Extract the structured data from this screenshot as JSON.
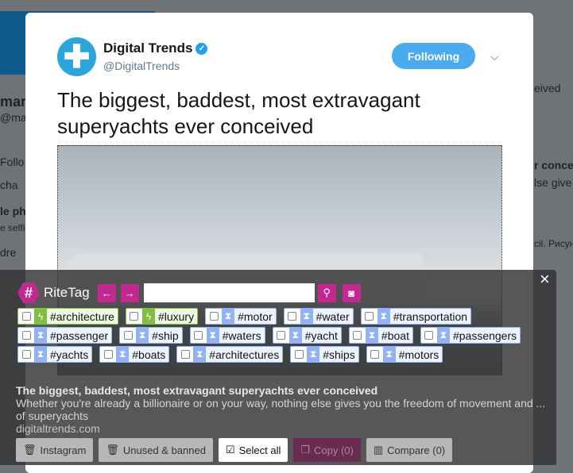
{
  "background": {
    "fragments": [
      "mar",
      "@mar",
      "le ph",
      "e selfie",
      "Follo",
      "dre",
      "cha",
      "eived",
      "r conce",
      "lse give",
      "cil. Рисун"
    ]
  },
  "tweet": {
    "author_name": "Digital Trends",
    "author_handle": "@DigitalTrends",
    "follow_label": "Following",
    "title": "The biggest, baddest, most extravagant superyachts ever conceived",
    "card_title": "The biggest, baddest, most extravagant superyachts ever conceived",
    "card_desc": "Whether you're already a billionaire or on your way, nothing else gives you the freedom of movement and ... of superyachts",
    "card_domain": "digitaltrends.com"
  },
  "ritetag": {
    "brand": "RiteTag",
    "close": "×",
    "search_value": "",
    "tags": [
      {
        "label": "#architecture",
        "status": "hot"
      },
      {
        "label": "#luxury",
        "status": "hot"
      },
      {
        "label": "#motor",
        "status": "slow"
      },
      {
        "label": "#water",
        "status": "slow"
      },
      {
        "label": "#transportation",
        "status": "slow"
      },
      {
        "label": "#passenger",
        "status": "slow"
      },
      {
        "label": "#ship",
        "status": "slow"
      },
      {
        "label": "#waters",
        "status": "slow"
      },
      {
        "label": "#yacht",
        "status": "slow"
      },
      {
        "label": "#boat",
        "status": "slow"
      },
      {
        "label": "#passengers",
        "status": "slow"
      },
      {
        "label": "#yachts",
        "status": "slow"
      },
      {
        "label": "#boats",
        "status": "slow"
      },
      {
        "label": "#architectures",
        "status": "slow"
      },
      {
        "label": "#ships",
        "status": "slow"
      },
      {
        "label": "#motors",
        "status": "slow"
      }
    ],
    "buttons": {
      "instagram": "Instagram",
      "unused": "Unused & banned",
      "select_all": "Select all",
      "copy": "Copy (0)",
      "compare": "Compare (0)"
    },
    "colors": {
      "brand": "#c2288f",
      "hot": "#7fbf41",
      "slow": "#91b2f4"
    }
  }
}
